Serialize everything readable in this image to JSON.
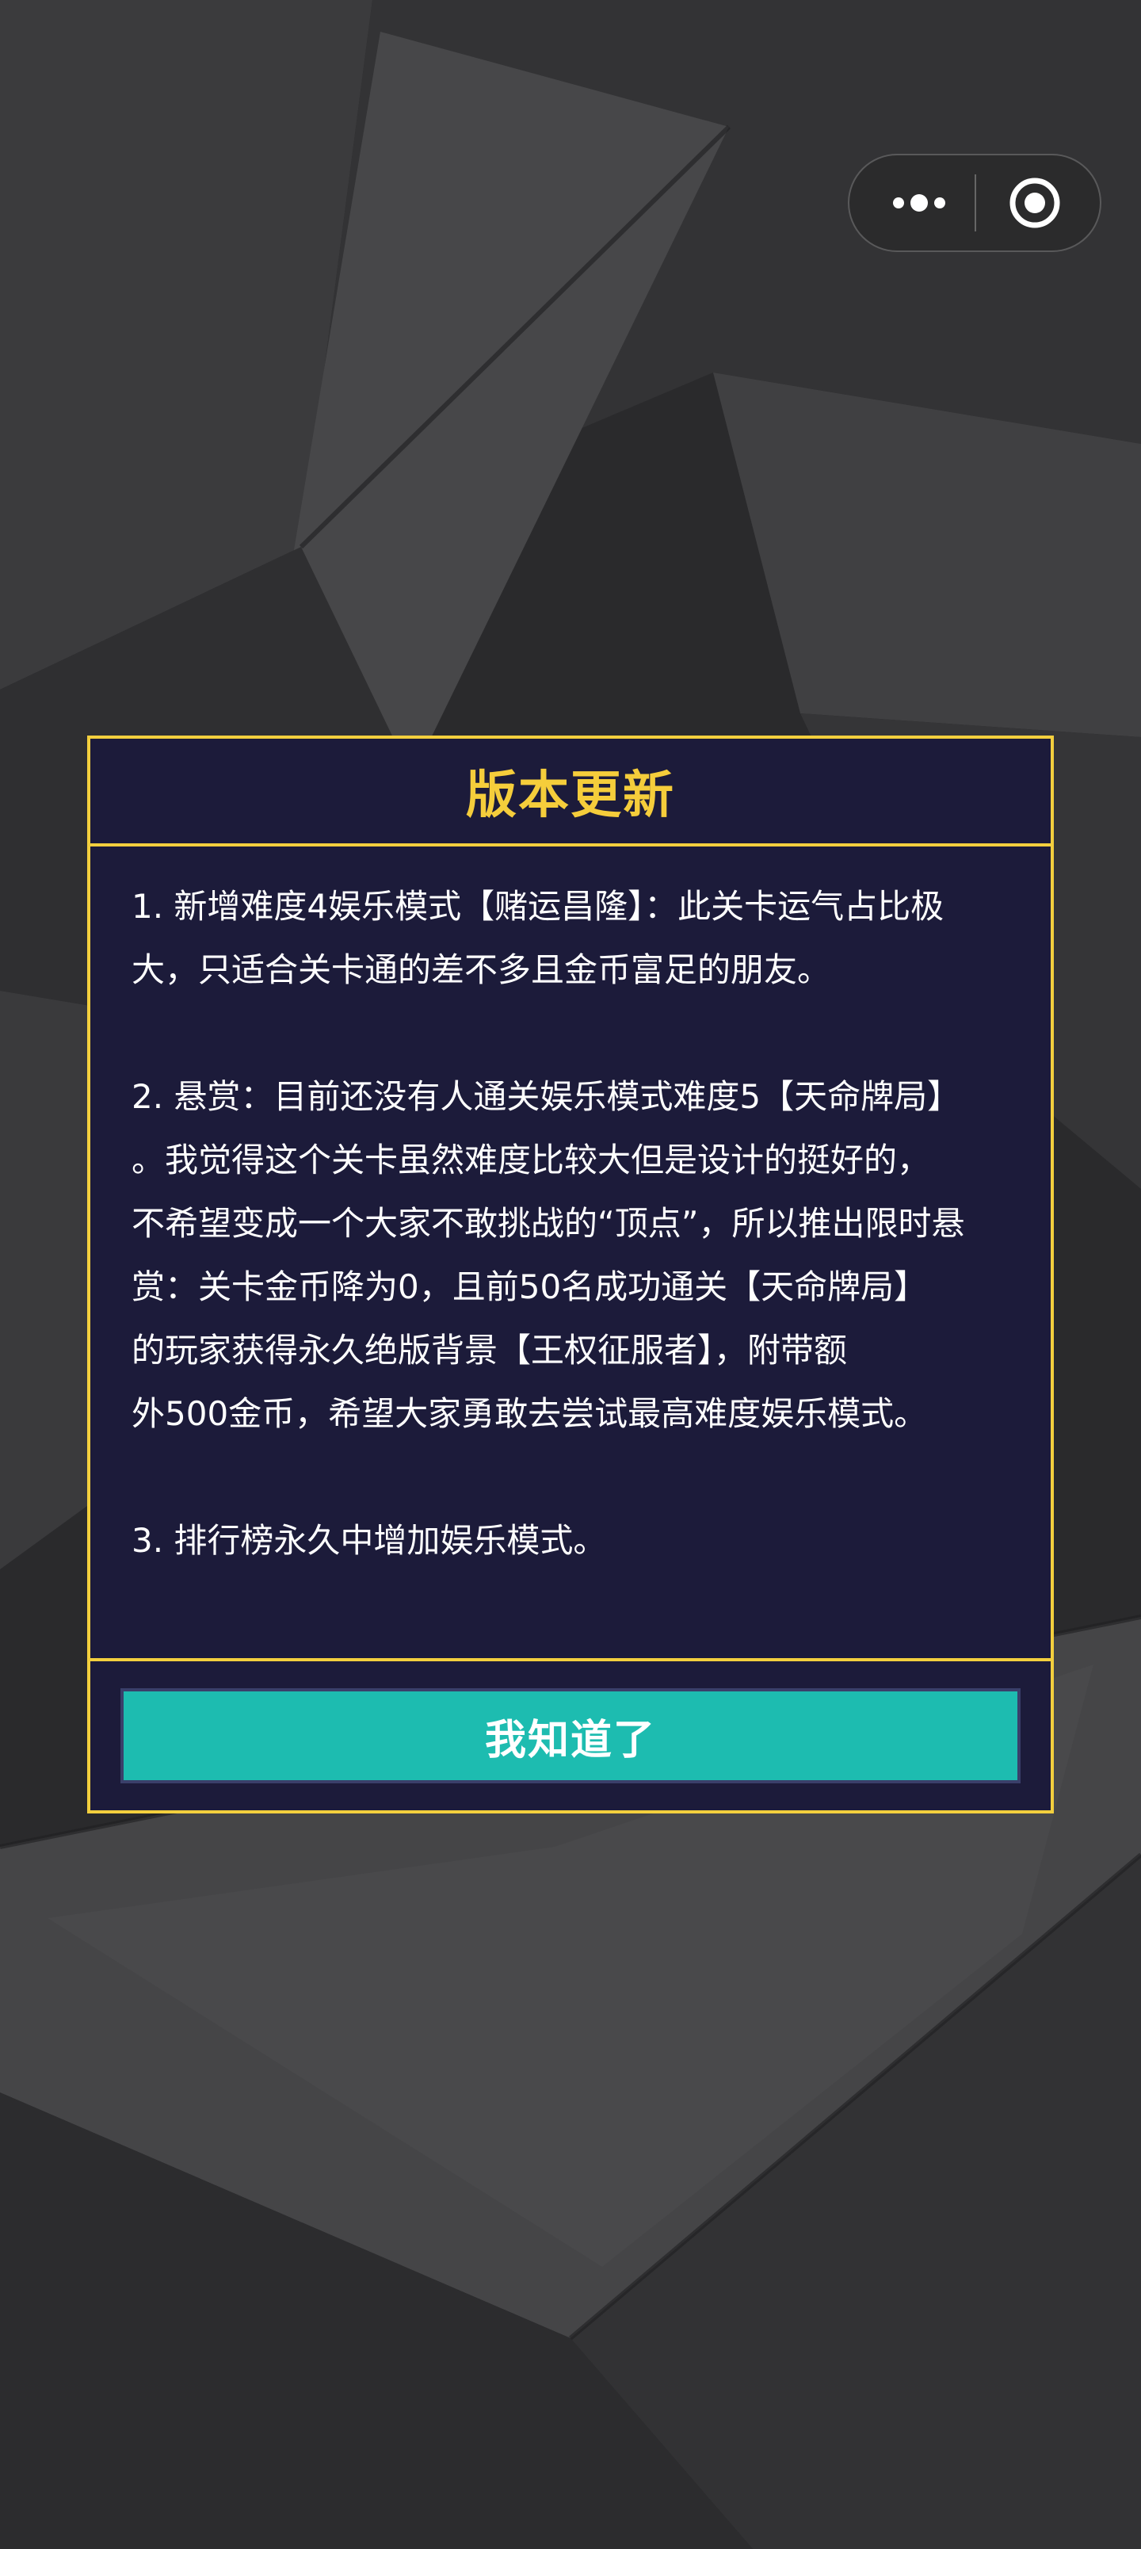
{
  "capsule": {
    "more_icon": "more-dots-icon",
    "close_icon": "target-circle-icon"
  },
  "dialog": {
    "title": "版本更新",
    "lines": [
      "1. 新增难度4娱乐模式【赌运昌隆】：此关卡运气占比极",
      "大，只适合关卡通的差不多且金币富足的朋友。",
      "2. 悬赏：目前还没有人通关娱乐模式难度5【天命牌局】",
      "。我觉得这个关卡虽然难度比较大但是设计的挺好的，",
      "不希望变成一个大家不敢挑战的“顶点”，所以推出限时悬",
      "赏：关卡金币降为0，且前50名成功通关【天命牌局】",
      "的玩家获得永久绝版背景【王权征服者】，附带额",
      "外500金币，希望大家勇敢去尝试最高难度娱乐模式。",
      "3. 排行榜永久中增加娱乐模式。"
    ],
    "confirm_label": "我知道了"
  },
  "colors": {
    "modal_bg": "#1c1b3a",
    "border": "#f3cf3e",
    "title": "#f5cd3b",
    "button": "#1dbcb0"
  }
}
